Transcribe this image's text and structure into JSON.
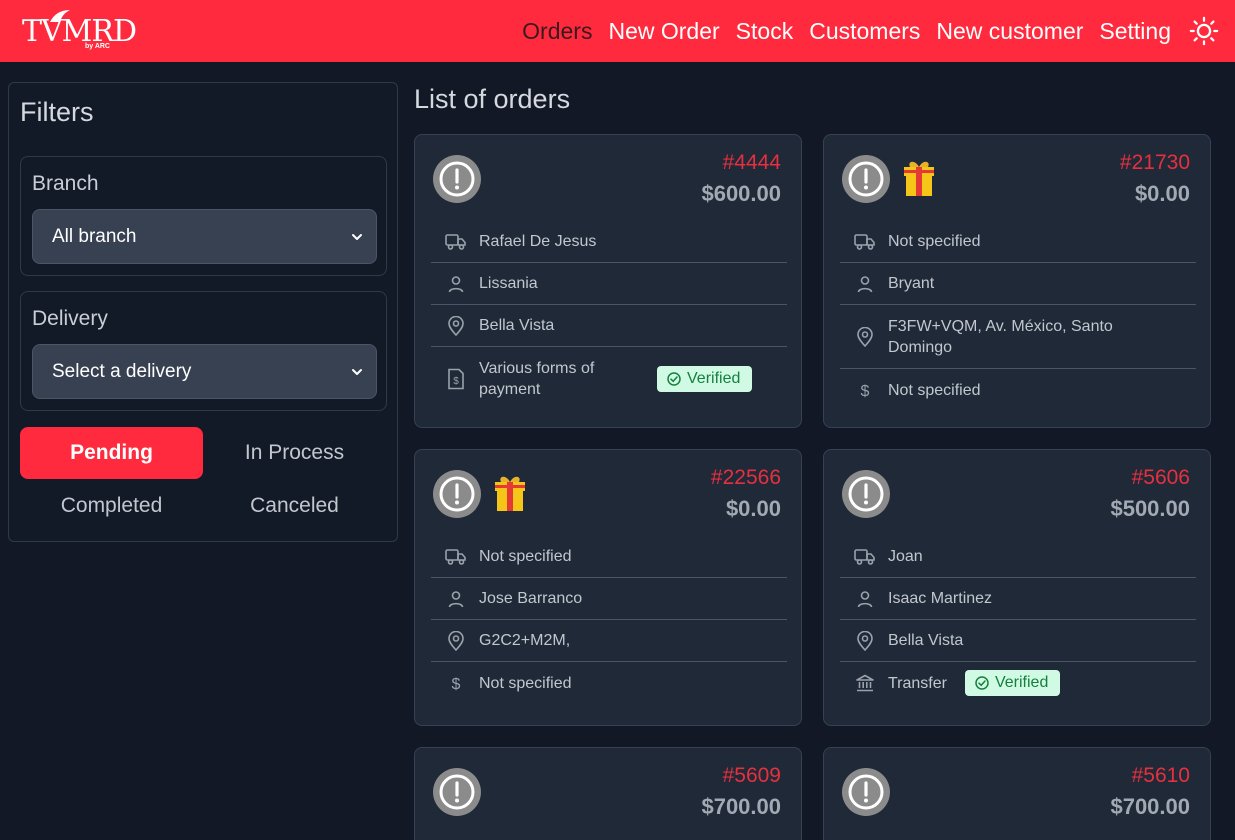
{
  "brand": {
    "logo_text": "TVMRD",
    "logo_sub": "by ARC"
  },
  "nav": {
    "items": [
      "Orders",
      "New Order",
      "Stock",
      "Customers",
      "New customer",
      "Setting"
    ],
    "active": "Orders"
  },
  "filters": {
    "title": "Filters",
    "branch": {
      "label": "Branch",
      "value": "All branch"
    },
    "delivery": {
      "label": "Delivery",
      "value": "Select a delivery"
    },
    "status_tabs": [
      "Pending",
      "In Process",
      "Completed",
      "Canceled"
    ],
    "active_status": "Pending"
  },
  "list": {
    "title": "List of orders",
    "orders": [
      {
        "number": "#4444",
        "total": "$600.00",
        "gift": false,
        "delivery": "Rafael De Jesus",
        "customer": "Lissania",
        "address": "Bella Vista",
        "payment": "Various forms of payment",
        "payment_icon": "invoice-icon",
        "verified": "Verified"
      },
      {
        "number": "#21730",
        "total": "$0.00",
        "gift": true,
        "delivery": "Not specified",
        "customer": "Bryant",
        "address": "F3FW+VQM, Av. México, Santo Domingo",
        "payment": "Not specified",
        "payment_icon": "dollar-icon",
        "verified": null
      },
      {
        "number": "#22566",
        "total": "$0.00",
        "gift": true,
        "delivery": "Not specified",
        "customer": "Jose Barranco",
        "address": "G2C2+M2M,",
        "payment": "Not specified",
        "payment_icon": "dollar-icon",
        "verified": null
      },
      {
        "number": "#5606",
        "total": "$500.00",
        "gift": false,
        "delivery": "Joan",
        "customer": "Isaac Martinez",
        "address": "Bella Vista",
        "payment": "Transfer",
        "payment_icon": "bank-icon",
        "verified": "Verified"
      },
      {
        "number": "#5609",
        "total": "$700.00",
        "gift": false
      },
      {
        "number": "#5610",
        "total": "$700.00",
        "gift": false
      }
    ]
  },
  "colors": {
    "header": "#ff2a3d",
    "background": "#121826",
    "card": "#1f2937",
    "order_number": "#e6303f",
    "verified_bg": "#d1fae5",
    "verified_text": "#15803d"
  }
}
